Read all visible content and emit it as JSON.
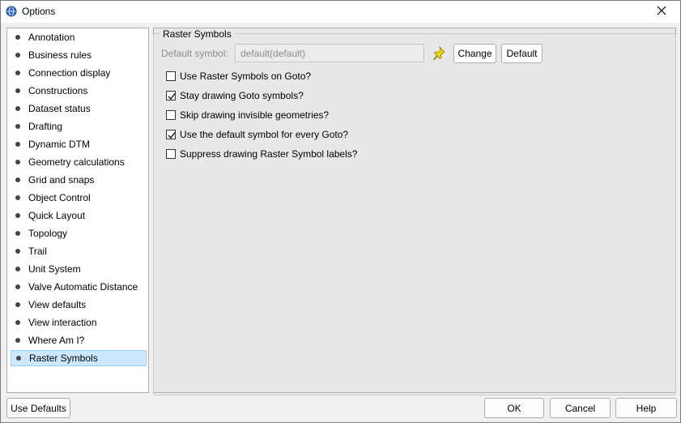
{
  "window": {
    "title": "Options"
  },
  "sidebar": {
    "items": [
      {
        "label": "Annotation",
        "selected": false
      },
      {
        "label": "Business rules",
        "selected": false
      },
      {
        "label": "Connection display",
        "selected": false
      },
      {
        "label": "Constructions",
        "selected": false
      },
      {
        "label": "Dataset status",
        "selected": false
      },
      {
        "label": "Drafting",
        "selected": false
      },
      {
        "label": "Dynamic DTM",
        "selected": false
      },
      {
        "label": "Geometry calculations",
        "selected": false
      },
      {
        "label": "Grid and snaps",
        "selected": false
      },
      {
        "label": "Object Control",
        "selected": false
      },
      {
        "label": "Quick Layout",
        "selected": false
      },
      {
        "label": "Topology",
        "selected": false
      },
      {
        "label": "Trail",
        "selected": false
      },
      {
        "label": "Unit System",
        "selected": false
      },
      {
        "label": "Valve Automatic Distance",
        "selected": false
      },
      {
        "label": "View defaults",
        "selected": false
      },
      {
        "label": "View interaction",
        "selected": false
      },
      {
        "label": "Where Am I?",
        "selected": false
      },
      {
        "label": "Raster Symbols",
        "selected": true
      }
    ]
  },
  "panel": {
    "group_title": "Raster Symbols",
    "default_symbol_label": "Default symbol:",
    "default_symbol_value": "default(default)",
    "change_label": "Change",
    "default_label": "Default",
    "options": [
      {
        "label": "Use Raster Symbols on Goto?",
        "checked": false
      },
      {
        "label": "Stay drawing Goto symbols?",
        "checked": true
      },
      {
        "label": "Skip drawing invisible geometries?",
        "checked": false
      },
      {
        "label": "Use the default symbol for every Goto?",
        "checked": true
      },
      {
        "label": "Suppress drawing Raster Symbol labels?",
        "checked": false
      }
    ]
  },
  "footer": {
    "use_defaults_label": "Use Defaults",
    "ok_label": "OK",
    "cancel_label": "Cancel",
    "help_label": "Help"
  },
  "icons": {
    "app": "globe-icon",
    "close": "close-icon",
    "pin": "pushpin-icon",
    "bullet": "bullet-icon"
  },
  "colors": {
    "selection_bg": "#cce8ff",
    "selection_border": "#99d1ff",
    "pin": "#f2d600",
    "panel_bg": "#e8e8e8"
  }
}
